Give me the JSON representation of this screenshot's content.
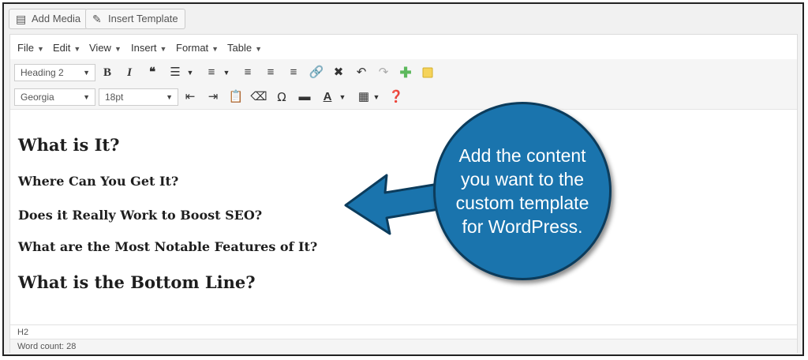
{
  "toolbar_top": {
    "add_media_label": "Add Media",
    "insert_template_label": "Insert Template"
  },
  "menubar": {
    "items": [
      "File",
      "Edit",
      "View",
      "Insert",
      "Format",
      "Table"
    ]
  },
  "format_select": {
    "value": "Heading 2"
  },
  "font_select": {
    "value": "Georgia"
  },
  "size_select": {
    "value": "18pt"
  },
  "content": {
    "headings": [
      "What is It?",
      "Where Can You Get It?",
      "Does it Really Work to Boost SEO?",
      "What are the Most Notable Features of It?",
      "What is the Bottom Line?"
    ]
  },
  "status": {
    "path": "H2",
    "word_count": "Word count: 28"
  },
  "callout": {
    "text": "Add the content you want to the custom template for WordPress."
  },
  "colors": {
    "callout_fill": "#1a74ad",
    "callout_border": "#0c3c5c",
    "plus_icon": "#5cb85c",
    "note_icon": "#f5d35a"
  }
}
